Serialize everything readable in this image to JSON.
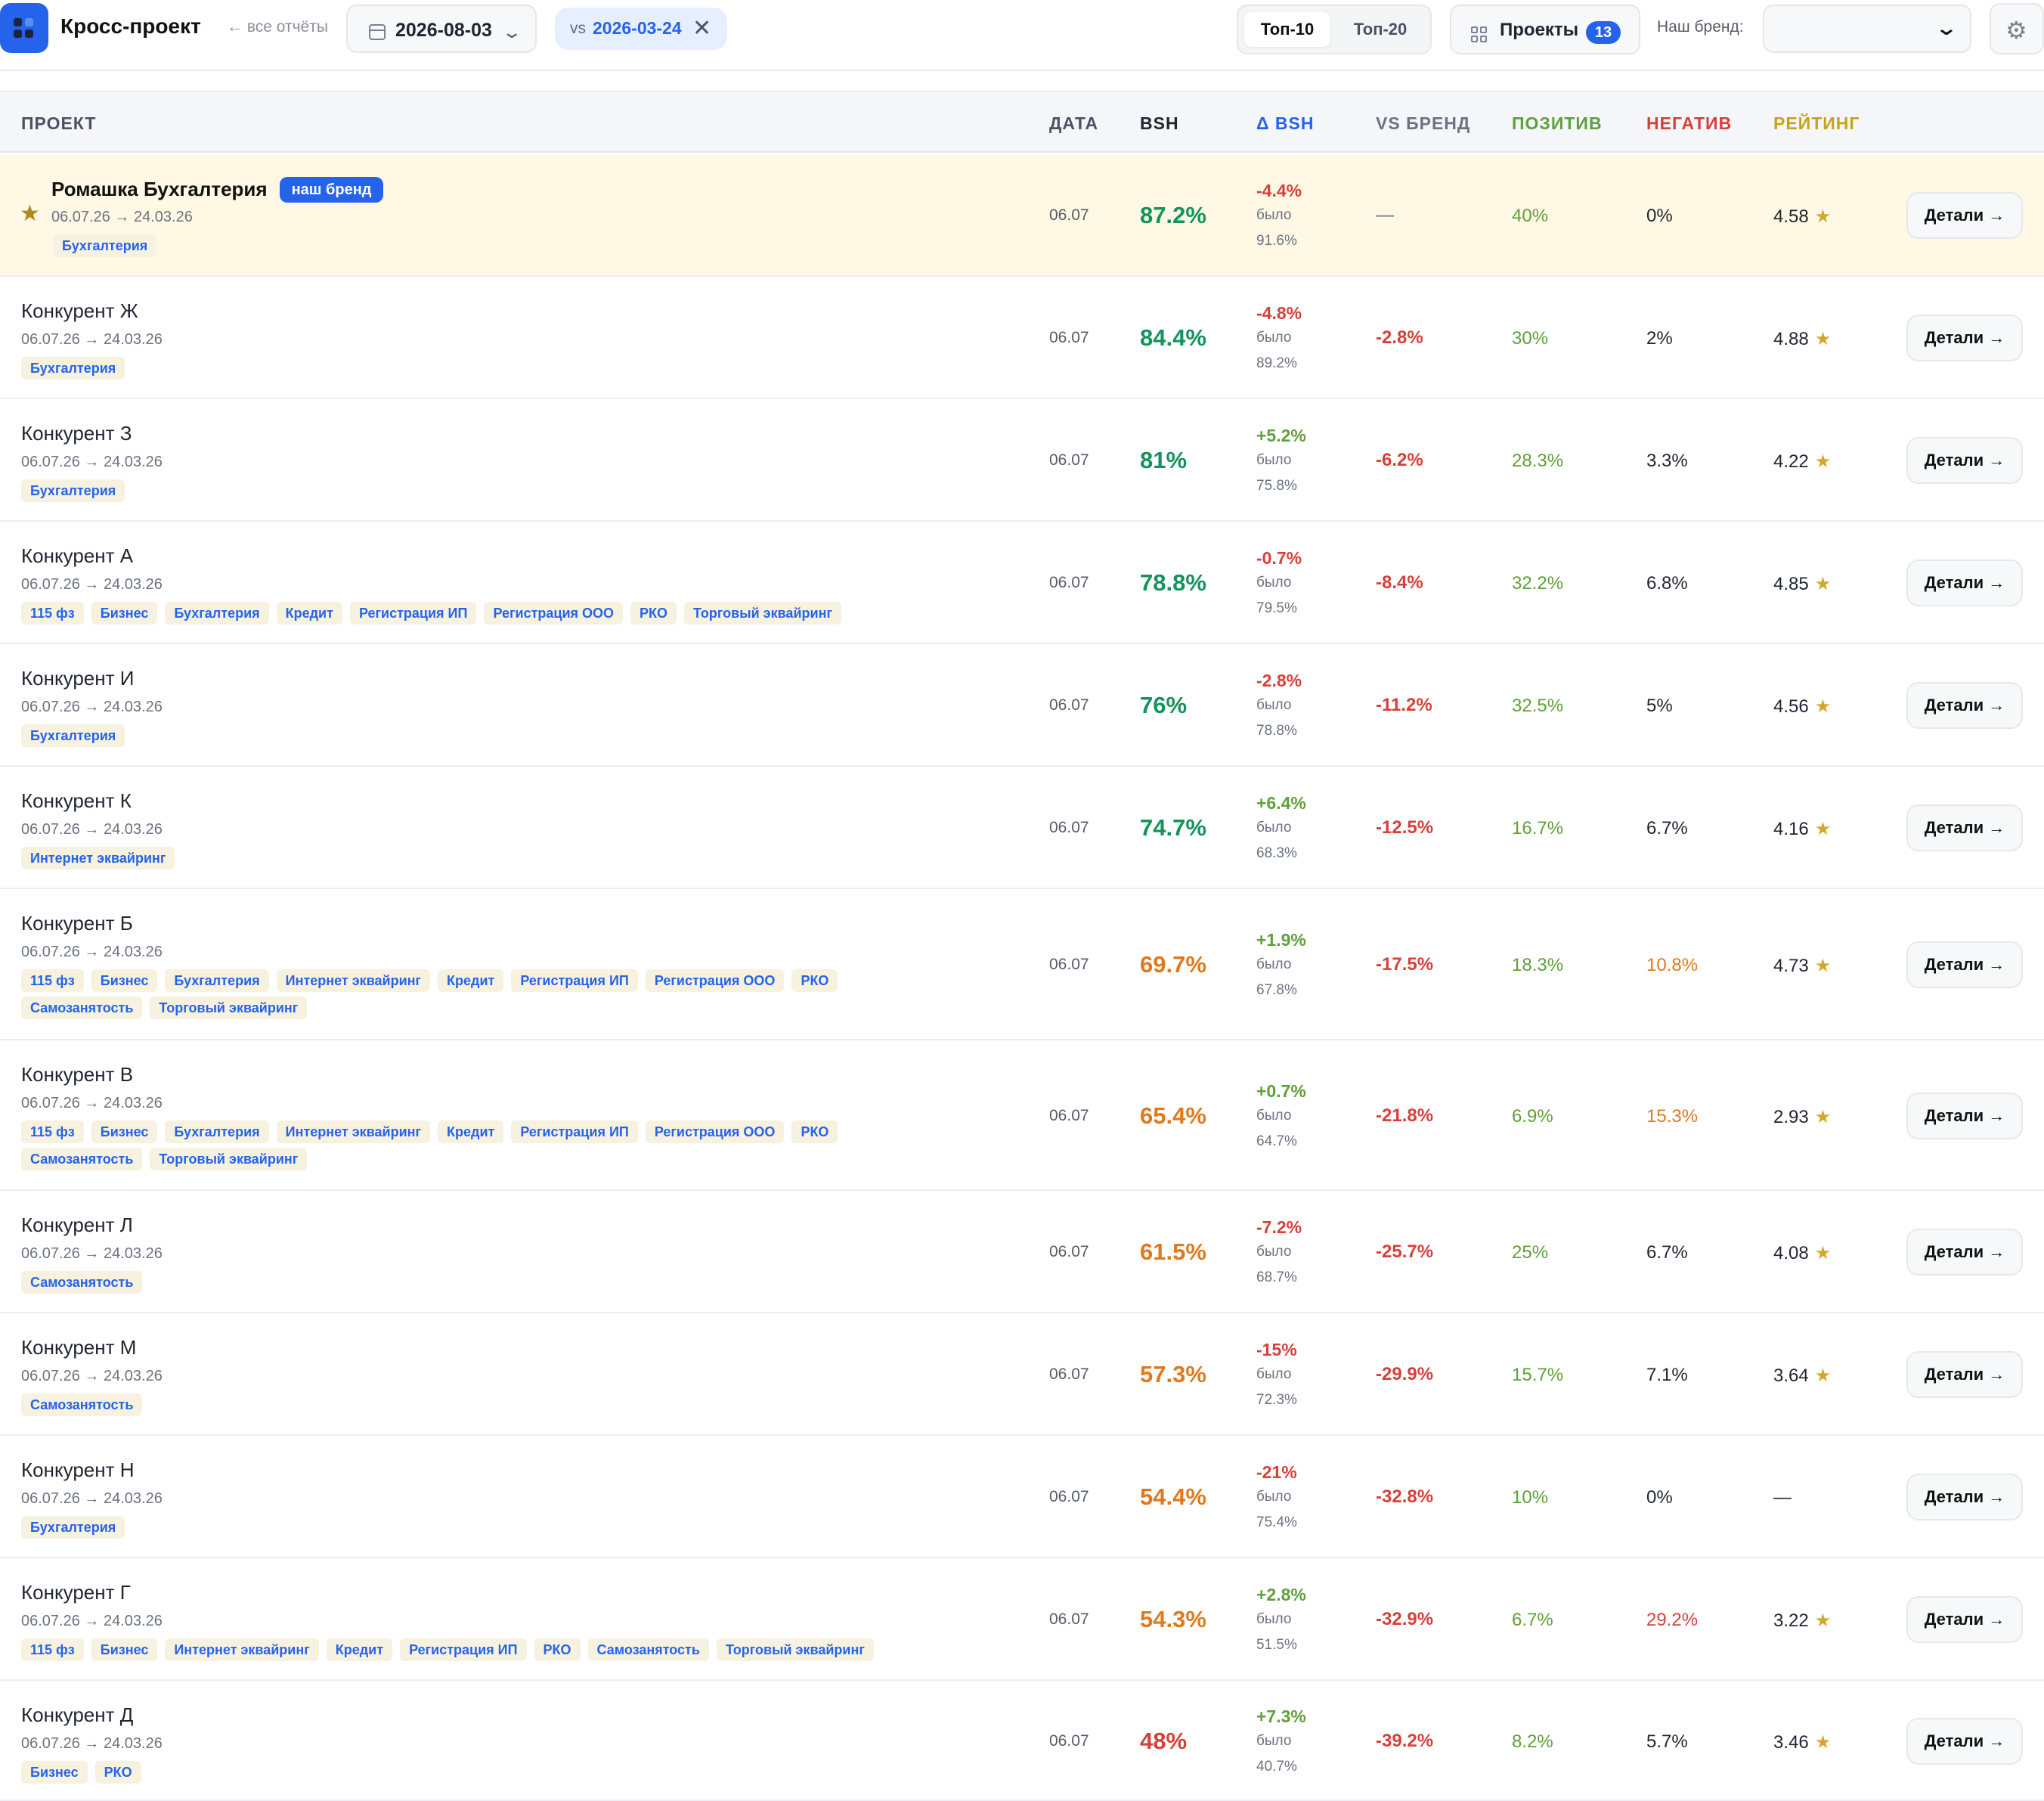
{
  "header": {
    "title": "Кросс-проект",
    "back_link": "← все отчёты",
    "date_value": "2026-08-03",
    "compare_prefix": "vs",
    "compare_date": "2026-03-24",
    "top10_label": "Топ-10",
    "top20_label": "Топ-20",
    "projects_label": "Проекты",
    "projects_count": "13",
    "brand_label": "Наш бренд:",
    "brand_value": ""
  },
  "columns": {
    "project": "ПРОЕКТ",
    "date": "ДАТА",
    "bsh": "BSH",
    "delta": "Δ BSH",
    "vs": "VS БРЕНД",
    "positive": "ПОЗИТИВ",
    "negative": "НЕГАТИВ",
    "rating": "РЕЙТИНГ"
  },
  "colors": {
    "accent": "#2563eb",
    "good": "#14935c",
    "mid": "#e0791d",
    "bad": "#d6403a",
    "positive": "#5fa03a",
    "rating": "#c9a317",
    "ours_row_bg": "#fff8e4"
  },
  "labels": {
    "ours_badge": "наш бренд",
    "was": "было",
    "details": "Детали →",
    "rating_star": "★"
  },
  "rows": [
    {
      "name": "Ромашка Бухгалтерия",
      "ours": true,
      "range": "06.07.26 → 24.03.26",
      "tags": [
        "Бухгалтерия"
      ],
      "date": "06.07",
      "bsh": "87.2%",
      "bsh_level": "good",
      "delta": "-4.4%",
      "was": "91.6%",
      "vs": "—",
      "pos": "40%",
      "neg": "0%",
      "neg_level": "normal",
      "rating": "4.58"
    },
    {
      "name": "Конкурент Ж",
      "ours": false,
      "range": "06.07.26 → 24.03.26",
      "tags": [
        "Бухгалтерия"
      ],
      "date": "06.07",
      "bsh": "84.4%",
      "bsh_level": "good",
      "delta": "-4.8%",
      "was": "89.2%",
      "vs": "-2.8%",
      "pos": "30%",
      "neg": "2%",
      "neg_level": "normal",
      "rating": "4.88"
    },
    {
      "name": "Конкурент З",
      "ours": false,
      "range": "06.07.26 → 24.03.26",
      "tags": [
        "Бухгалтерия"
      ],
      "date": "06.07",
      "bsh": "81%",
      "bsh_level": "good",
      "delta": "+5.2%",
      "was": "75.8%",
      "vs": "-6.2%",
      "pos": "28.3%",
      "neg": "3.3%",
      "neg_level": "normal",
      "rating": "4.22"
    },
    {
      "name": "Конкурент А",
      "ours": false,
      "range": "06.07.26 → 24.03.26",
      "tags": [
        "115 фз",
        "Бизнес",
        "Бухгалтерия",
        "Кредит",
        "Регистрация ИП",
        "Регистрация ООО",
        "РКО",
        "Торговый эквайринг"
      ],
      "date": "06.07",
      "bsh": "78.8%",
      "bsh_level": "good",
      "delta": "-0.7%",
      "was": "79.5%",
      "vs": "-8.4%",
      "pos": "32.2%",
      "neg": "6.8%",
      "neg_level": "normal",
      "rating": "4.85"
    },
    {
      "name": "Конкурент И",
      "ours": false,
      "range": "06.07.26 → 24.03.26",
      "tags": [
        "Бухгалтерия"
      ],
      "date": "06.07",
      "bsh": "76%",
      "bsh_level": "good",
      "delta": "-2.8%",
      "was": "78.8%",
      "vs": "-11.2%",
      "pos": "32.5%",
      "neg": "5%",
      "neg_level": "normal",
      "rating": "4.56"
    },
    {
      "name": "Конкурент К",
      "ours": false,
      "range": "06.07.26 → 24.03.26",
      "tags": [
        "Интернет эквайринг"
      ],
      "date": "06.07",
      "bsh": "74.7%",
      "bsh_level": "good",
      "delta": "+6.4%",
      "was": "68.3%",
      "vs": "-12.5%",
      "pos": "16.7%",
      "neg": "6.7%",
      "neg_level": "normal",
      "rating": "4.16"
    },
    {
      "name": "Конкурент Б",
      "ours": false,
      "range": "06.07.26 → 24.03.26",
      "tags": [
        "115 фз",
        "Бизнес",
        "Бухгалтерия",
        "Интернет эквайринг",
        "Кредит",
        "Регистрация ИП",
        "Регистрация ООО",
        "РКО",
        "Самозанятость",
        "Торговый эквайринг"
      ],
      "date": "06.07",
      "bsh": "69.7%",
      "bsh_level": "mid",
      "delta": "+1.9%",
      "was": "67.8%",
      "vs": "-17.5%",
      "pos": "18.3%",
      "neg": "10.8%",
      "neg_level": "mid",
      "rating": "4.73"
    },
    {
      "name": "Конкурент В",
      "ours": false,
      "range": "06.07.26 → 24.03.26",
      "tags": [
        "115 фз",
        "Бизнес",
        "Бухгалтерия",
        "Интернет эквайринг",
        "Кредит",
        "Регистрация ИП",
        "Регистрация ООО",
        "РКО",
        "Самозанятость",
        "Торговый эквайринг"
      ],
      "date": "06.07",
      "bsh": "65.4%",
      "bsh_level": "mid",
      "delta": "+0.7%",
      "was": "64.7%",
      "vs": "-21.8%",
      "pos": "6.9%",
      "neg": "15.3%",
      "neg_level": "mid",
      "rating": "2.93"
    },
    {
      "name": "Конкурент Л",
      "ours": false,
      "range": "06.07.26 → 24.03.26",
      "tags": [
        "Самозанятость"
      ],
      "date": "06.07",
      "bsh": "61.5%",
      "bsh_level": "mid",
      "delta": "-7.2%",
      "was": "68.7%",
      "vs": "-25.7%",
      "pos": "25%",
      "neg": "6.7%",
      "neg_level": "normal",
      "rating": "4.08"
    },
    {
      "name": "Конкурент М",
      "ours": false,
      "range": "06.07.26 → 24.03.26",
      "tags": [
        "Самозанятость"
      ],
      "date": "06.07",
      "bsh": "57.3%",
      "bsh_level": "mid",
      "delta": "-15%",
      "was": "72.3%",
      "vs": "-29.9%",
      "pos": "15.7%",
      "neg": "7.1%",
      "neg_level": "normal",
      "rating": "3.64"
    },
    {
      "name": "Конкурент Н",
      "ours": false,
      "range": "06.07.26 → 24.03.26",
      "tags": [
        "Бухгалтерия"
      ],
      "date": "06.07",
      "bsh": "54.4%",
      "bsh_level": "mid",
      "delta": "-21%",
      "was": "75.4%",
      "vs": "-32.8%",
      "pos": "10%",
      "neg": "0%",
      "neg_level": "normal",
      "rating": "—"
    },
    {
      "name": "Конкурент Г",
      "ours": false,
      "range": "06.07.26 → 24.03.26",
      "tags": [
        "115 фз",
        "Бизнес",
        "Интернет эквайринг",
        "Кредит",
        "Регистрация ИП",
        "РКО",
        "Самозанятость",
        "Торговый эквайринг"
      ],
      "date": "06.07",
      "bsh": "54.3%",
      "bsh_level": "mid",
      "delta": "+2.8%",
      "was": "51.5%",
      "vs": "-32.9%",
      "pos": "6.7%",
      "neg": "29.2%",
      "neg_level": "bad",
      "rating": "3.22"
    },
    {
      "name": "Конкурент Д",
      "ours": false,
      "range": "06.07.26 → 24.03.26",
      "tags": [
        "Бизнес",
        "РКО"
      ],
      "date": "06.07",
      "bsh": "48%",
      "bsh_level": "bad",
      "delta": "+7.3%",
      "was": "40.7%",
      "vs": "-39.2%",
      "pos": "8.2%",
      "neg": "5.7%",
      "neg_level": "normal",
      "rating": "3.46"
    }
  ]
}
